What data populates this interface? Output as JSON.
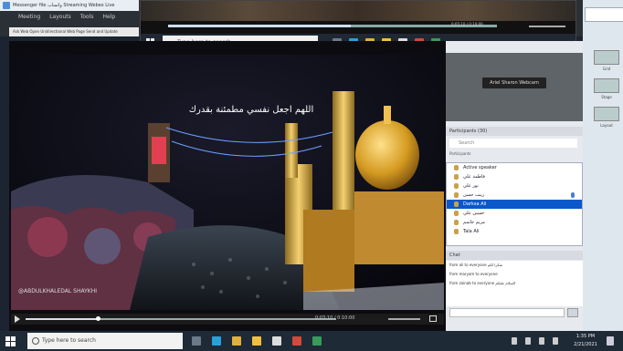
{
  "background_window": {
    "title": "Messenger file  واتساب  Streaming  Webex Live",
    "menu": [
      "Meeting",
      "Layouts",
      "Tools",
      "Help"
    ],
    "address": "Ask Web Open Unidirectional  Web Page  Send and Update"
  },
  "overlay_player": {
    "time": "0:05:10 / 0:10:00",
    "search_placeholder": "Type here to search"
  },
  "video": {
    "caption": "اللهم اجعل نفسي مطمئنة بقدرك",
    "watermark": "@ABDULKHALEDAL SHAYKHI",
    "time": "0:03:10 / 0:10:00"
  },
  "meeting": {
    "name_badge": "Ariel Sharon Webcam",
    "participants_header": "Participants (30)",
    "participants_search": "Search",
    "participants_status": "Participants",
    "participants": [
      {
        "name": "Active speaker",
        "selected": false,
        "mic": false
      },
      {
        "name": "فاطمة علي",
        "selected": false,
        "mic": false
      },
      {
        "name": "نور علي",
        "selected": false,
        "mic": false
      },
      {
        "name": "زينب حسن",
        "selected": false,
        "mic": true
      },
      {
        "name": "Darksa Ali",
        "selected": true,
        "mic": false
      },
      {
        "name": "حسين علي",
        "selected": false,
        "mic": false
      },
      {
        "name": "مريم جاسم",
        "selected": false,
        "mic": false
      },
      {
        "name": "Tala Ali",
        "selected": false,
        "mic": false
      }
    ],
    "chat_header": "Chat",
    "chat": [
      "from ali to everyone  شكرا لكم",
      "from maryam to everyone",
      "from zainab to everyone  السلام عليكم"
    ]
  },
  "side_panel": {
    "labels": [
      "Grid",
      "Stage",
      "Layout"
    ]
  },
  "taskbar": {
    "search_placeholder": "Type here to search",
    "time": "1:35 PM",
    "date": "2/21/2021"
  },
  "colors": {
    "accent": "#0a58ca",
    "taskbar": "#1e2a36",
    "panel": "#e6e9ee"
  },
  "icons": [
    "windows-start-icon",
    "search-icon",
    "edge-icon",
    "file-explorer-icon",
    "store-icon",
    "mail-icon",
    "office-icon",
    "webex-icon",
    "play-icon",
    "volume-icon",
    "fullscreen-icon",
    "send-icon",
    "mic-icon"
  ]
}
